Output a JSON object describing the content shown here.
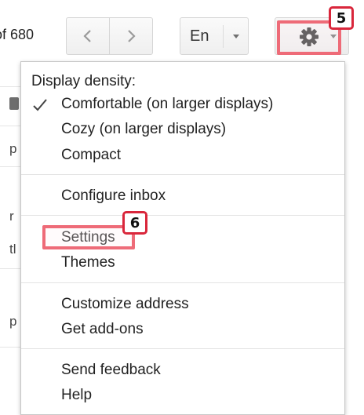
{
  "toolbar": {
    "count_text": "of 680",
    "language_label": "En"
  },
  "background": {
    "fragments": [
      "p",
      "r",
      "tl",
      "p"
    ]
  },
  "menu": {
    "density_heading": "Display density:",
    "density_options": [
      {
        "label": "Comfortable (on larger displays)",
        "selected": true
      },
      {
        "label": "Cozy (on larger displays)",
        "selected": false
      },
      {
        "label": "Compact",
        "selected": false
      }
    ],
    "configure_inbox": "Configure inbox",
    "settings": "Settings",
    "themes": "Themes",
    "customize_address": "Customize address",
    "get_addons": "Get add-ons",
    "send_feedback": "Send feedback",
    "help": "Help"
  },
  "annotations": {
    "step_gear": "5",
    "step_settings": "6"
  },
  "colors": {
    "highlight": "#ee6b78",
    "badge_border": "#d9263b"
  },
  "icons": {
    "prev": "chevron-left-icon",
    "next": "chevron-right-icon",
    "gear": "gear-icon",
    "check": "check-icon",
    "caret": "caret-down-icon"
  }
}
